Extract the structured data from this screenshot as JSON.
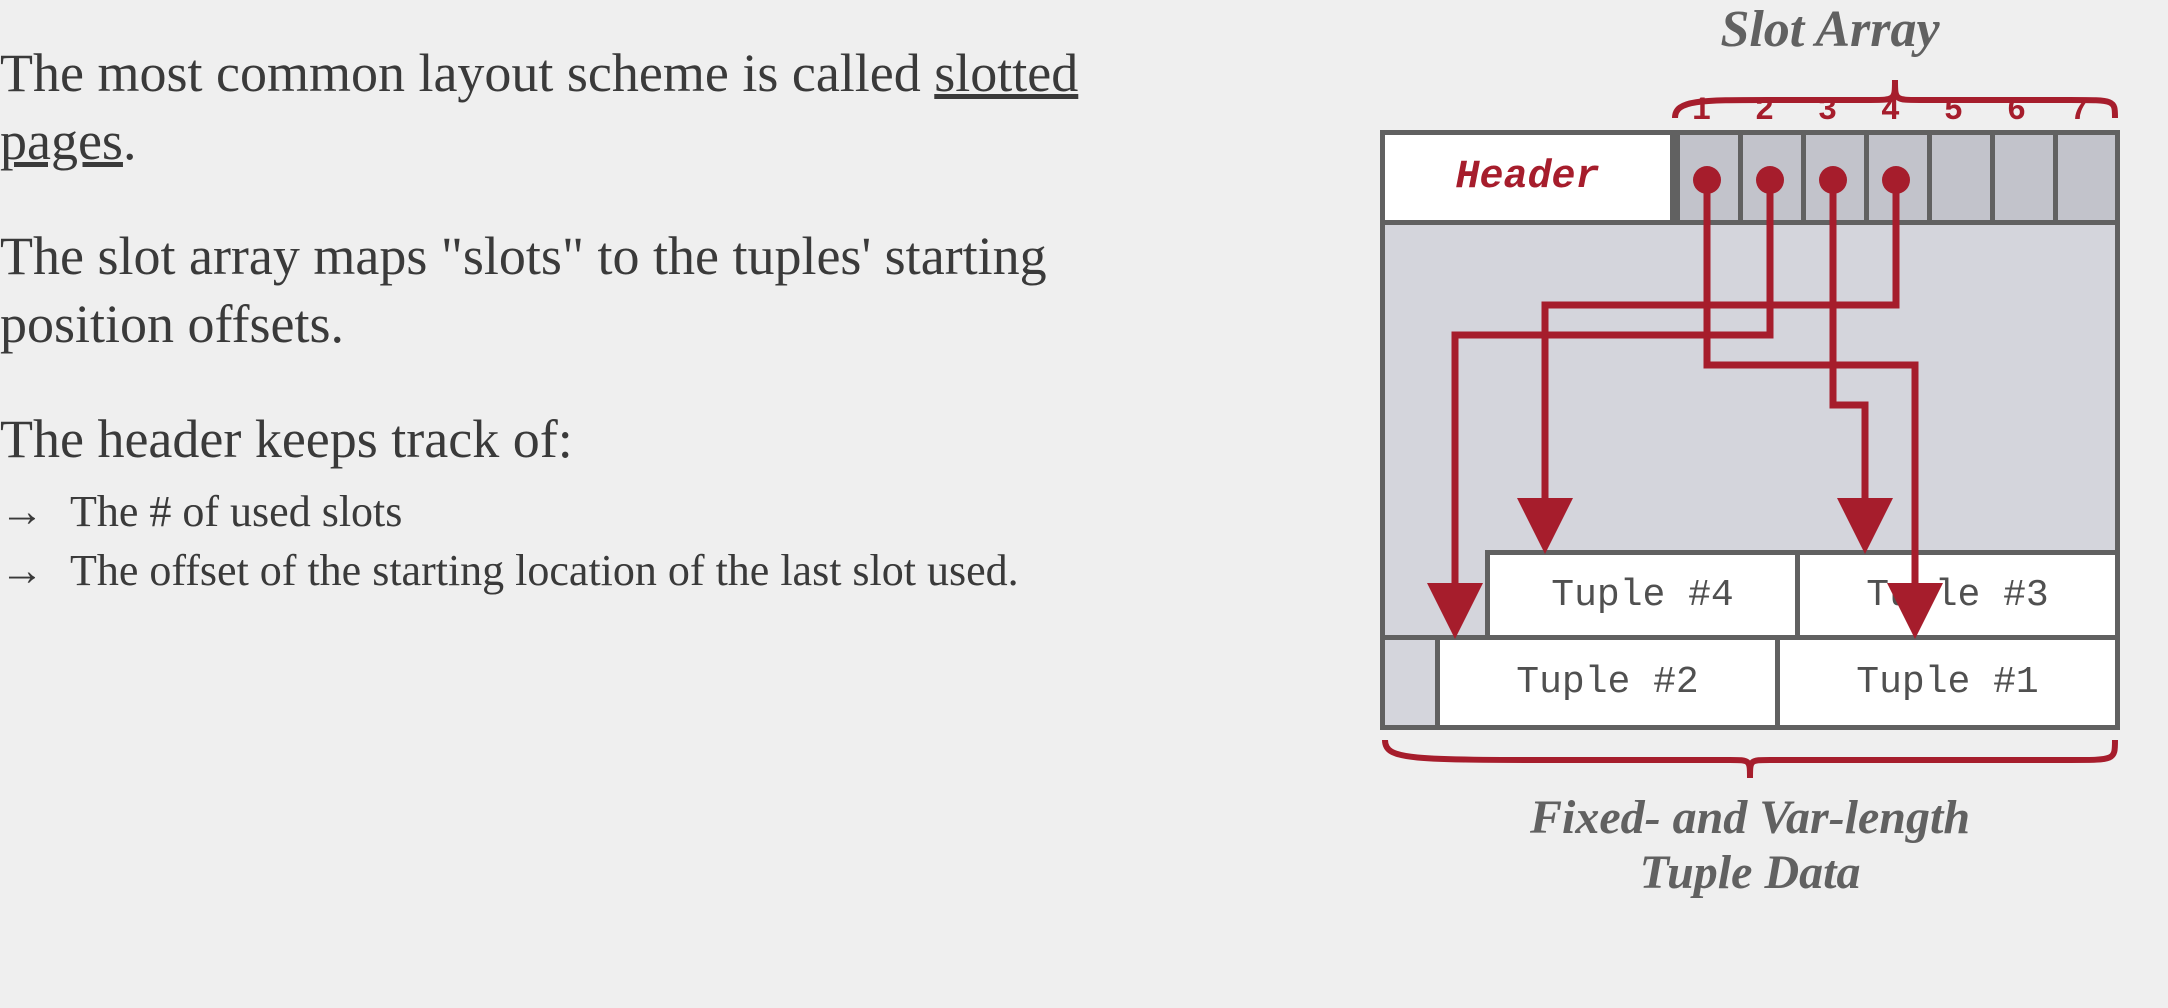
{
  "text": {
    "p1a": "The most common layout scheme is called ",
    "p1b": "slotted pages",
    "p1c": ".",
    "p2": "The slot array maps \"slots\" to the tuples' starting position offsets.",
    "p3": "The header keeps track of:",
    "b1": "The # of used slots",
    "b2": "The offset of the starting location of the last slot used.",
    "arrow": "→"
  },
  "diagram": {
    "slot_array_title": "Slot Array",
    "bottom_title_l1": "Fixed- and Var-length",
    "bottom_title_l2": "Tuple Data",
    "header_label": "Header",
    "slot_numbers": [
      "1",
      "2",
      "3",
      "4",
      "5",
      "6",
      "7"
    ],
    "tuples": {
      "t1": "Tuple #1",
      "t2": "Tuple #2",
      "t3": "Tuple #3",
      "t4": "Tuple #4"
    },
    "colors": {
      "accent": "#a61d2c",
      "border": "#616161",
      "page_fill": "#d4d5dc",
      "slot_fill": "#c2c3cb"
    }
  }
}
